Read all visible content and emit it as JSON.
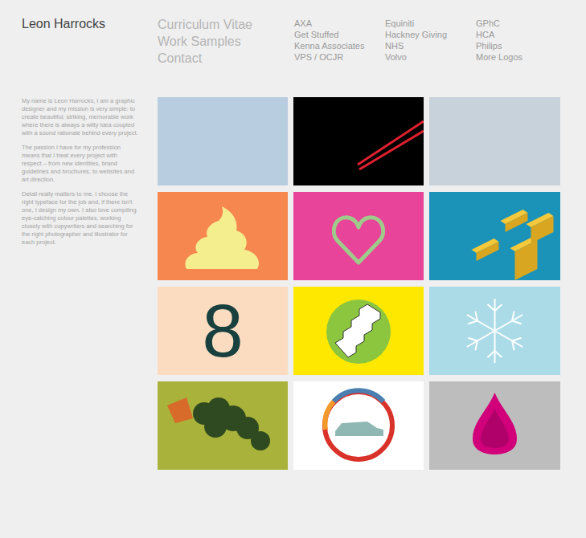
{
  "site": {
    "title": "Leon Harrocks"
  },
  "nav": [
    "Curriculum Vitae",
    "Work Samples",
    "Contact"
  ],
  "clients": [
    [
      "AXA",
      "Get Stuffed",
      "Kenna Associates",
      "VPS / OCJR"
    ],
    [
      "Equiniti",
      "Hackney Giving",
      "NHS",
      "Volvo"
    ],
    [
      "GPhC",
      "HCA",
      "Philips",
      "More Logos"
    ]
  ],
  "intro": [
    "My name is Leon Harrocks, I am a graphic designer and my mission is very simple: to create beautiful, striking, memorable work where there is always a witty idea coupled with a sound rationale behind every project.",
    "The passion I have for my profession means that I treat every project with respect – from new identities, brand guidelines and brochures, to websites and art direction.",
    "Detail really matters to me. I choose the right typeface for the job and, if there isn't one, I design my own. I also love compiling eye-catching colour palettes, working closely with copywriters and searching for the right photographer and illustrator for each project."
  ],
  "tiles": [
    {
      "kind": "photo",
      "color": "#b9cde0"
    },
    {
      "kind": "chopsticks",
      "color": "#000000"
    },
    {
      "kind": "photo",
      "color": "#c8d2db"
    },
    {
      "kind": "swirl",
      "color": "#f5874f"
    },
    {
      "kind": "heart",
      "color": "#e8449a"
    },
    {
      "kind": "blocks",
      "color": "#1b93b8"
    },
    {
      "kind": "numeral",
      "color": "#fcdcc0",
      "label": "8"
    },
    {
      "kind": "stairs",
      "color": "#ffe800"
    },
    {
      "kind": "snowflake",
      "color": "#aadbe6"
    },
    {
      "kind": "plant",
      "color": "#a9b23b"
    },
    {
      "kind": "car-ring",
      "color": "#ffffff"
    },
    {
      "kind": "drop",
      "color": "#bdbdbd"
    }
  ]
}
